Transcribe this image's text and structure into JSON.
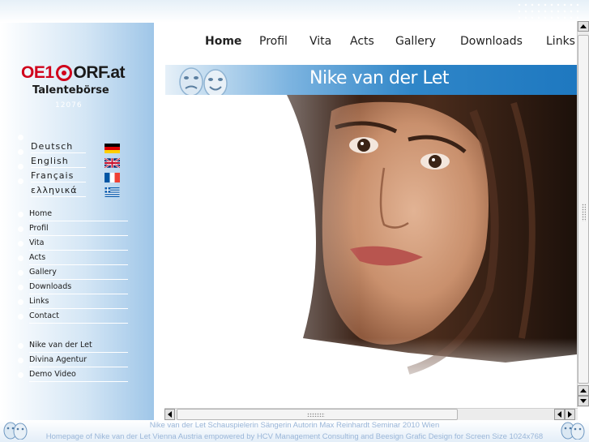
{
  "logo": {
    "brand_left": "OE1",
    "brand_right": "ORF.at",
    "subtitle": "Talentebörse",
    "counter": "12076"
  },
  "languages": [
    {
      "label": "Deutsch",
      "flag": "flag-germany-icon"
    },
    {
      "label": "English",
      "flag": "flag-uk-icon"
    },
    {
      "label": "Français",
      "flag": "flag-france-icon"
    },
    {
      "label": "ελληνικά",
      "flag": "flag-greece-icon"
    }
  ],
  "sidebar_nav": [
    {
      "label": "Home"
    },
    {
      "label": "Profil"
    },
    {
      "label": "Vita"
    },
    {
      "label": "Acts"
    },
    {
      "label": "Gallery"
    },
    {
      "label": "Downloads"
    },
    {
      "label": "Links"
    },
    {
      "label": "Contact"
    }
  ],
  "sidebar_links": [
    {
      "label": "Nike van der Let"
    },
    {
      "label": "Divina Agentur"
    },
    {
      "label": "Demo Video"
    }
  ],
  "top_nav": [
    {
      "label": "Home",
      "active": true
    },
    {
      "label": "Profil"
    },
    {
      "label": "Vita"
    },
    {
      "label": "Acts"
    },
    {
      "label": "Gallery"
    },
    {
      "label": "Downloads"
    },
    {
      "label": "Links"
    }
  ],
  "banner": {
    "title": "Nike van der Let",
    "icon": "theater-masks-icon"
  },
  "footer": {
    "line1": "Nike van der Let Schauspielerin Sängerin Autorin Max Reinhardt Seminar 2010 Wien",
    "line2": "Homepage of Nike van der Let Vienna Austria empowered by HCV Management Consulting and Beesign Grafic Design for Screen Size 1024x768"
  },
  "colors": {
    "brand_red": "#d0021b",
    "banner_blue": "#1e78c0",
    "sidebar_blue": "#9fc6e8",
    "footer_text": "#9ab6d8"
  }
}
